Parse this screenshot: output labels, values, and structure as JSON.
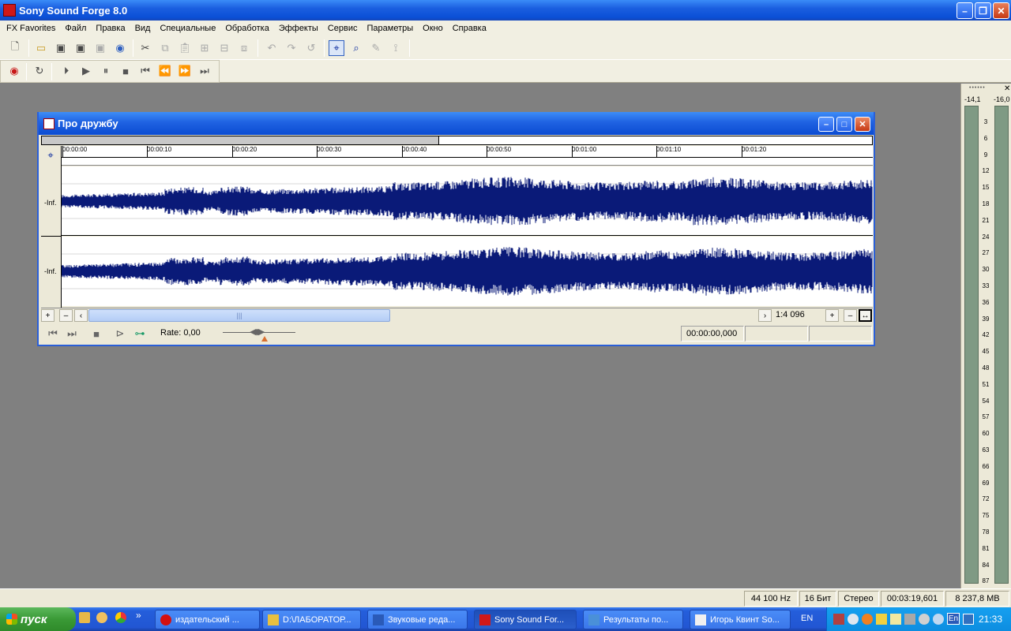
{
  "app": {
    "title": "Sony Sound Forge 8.0"
  },
  "menu": [
    "FX Favorites",
    "Файл",
    "Правка",
    "Вид",
    "Специальные",
    "Обработка",
    "Эффекты",
    "Сервис",
    "Параметры",
    "Окно",
    "Справка"
  ],
  "doc": {
    "title": "Про дружбу",
    "ruler_ticks": [
      "00:00:00",
      "00:00:10",
      "00:00:20",
      "00:00:30",
      "00:00:40",
      "00:00:50",
      "00:01:00",
      "00:01:10",
      "00:01:20"
    ],
    "channel_label": "-Inf.",
    "zoom": "1:4 096",
    "rate_label": "Rate: 0,00",
    "position": "00:00:00,000"
  },
  "meters": {
    "left_peak": "-14,1",
    "right_peak": "-16,0",
    "scale": [
      "3",
      "6",
      "9",
      "12",
      "15",
      "18",
      "21",
      "24",
      "27",
      "30",
      "33",
      "36",
      "39",
      "42",
      "45",
      "48",
      "51",
      "54",
      "57",
      "60",
      "63",
      "66",
      "69",
      "72",
      "75",
      "78",
      "81",
      "84",
      "87"
    ]
  },
  "status": {
    "sample_rate": "44 100 Hz",
    "bit_depth": "16 Бит",
    "channels": "Стерео",
    "length": "00:03:19,601",
    "size": "8 237,8 MB"
  },
  "taskbar": {
    "start_label": "пуск",
    "items": [
      {
        "label": "издательский ...",
        "icon": "opera-icon",
        "color": "#d41010"
      },
      {
        "label": "D:\\ЛАБОРАТОР...",
        "icon": "folder-icon",
        "color": "#e8c040"
      },
      {
        "label": "Звуковые реда...",
        "icon": "word-icon",
        "color": "#2a5ab8"
      },
      {
        "label": "Sony Sound For...",
        "icon": "soundforge-icon",
        "color": "#d01818"
      },
      {
        "label": "Результаты по...",
        "icon": "explorer-icon",
        "color": "#4a90d8"
      },
      {
        "label": "Игорь Квинт So...",
        "icon": "notepad-icon",
        "color": "#f0f0f0"
      }
    ],
    "lang": "EN",
    "tray_lang": "En",
    "clock": "21:33"
  }
}
